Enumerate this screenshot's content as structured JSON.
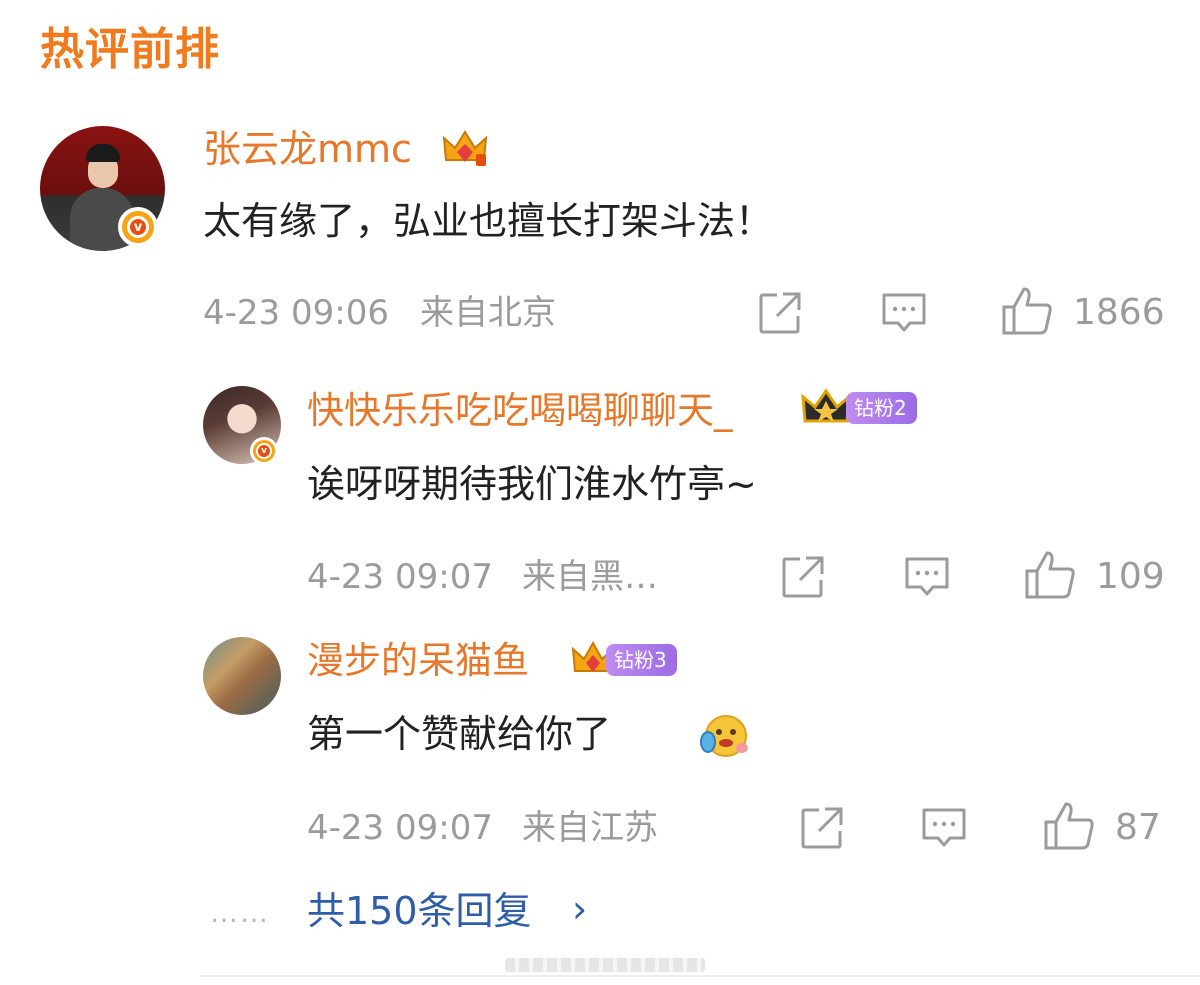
{
  "section_title": "热评前排",
  "comments": [
    {
      "username": "张云龙mmc",
      "content": "太有缘了，弘业也擅长打架斗法！",
      "time": "4-23 09:06",
      "location": "来自北京",
      "like_count": "1866"
    }
  ],
  "replies": [
    {
      "username": "快快乐乐吃吃喝喝聊聊天_",
      "fan_badge": "钻粉2",
      "content": "诶呀呀期待我们淮水竹亭~",
      "time": "4-23 09:07",
      "location": "来自黑…",
      "like_count": "109"
    },
    {
      "username": "漫步的呆猫鱼",
      "fan_badge": "钻粉3",
      "content": "第一个赞献给你了",
      "time": "4-23 09:07",
      "location": "来自江苏",
      "like_count": "87"
    }
  ],
  "more": {
    "dots": "……",
    "label": "共150条回复",
    "chevron": "›"
  },
  "colors": {
    "title": "#f07a1c",
    "username": "#e7772a",
    "link": "#2f5ea8",
    "meta": "#9b9b9b",
    "fan_badge": "#b07ff0",
    "verified": "#f6a314"
  },
  "icons": [
    "verified-badge-icon",
    "crown-icon",
    "share-icon",
    "comment-icon",
    "like-icon",
    "emoji-icon",
    "chevron-right-icon"
  ]
}
